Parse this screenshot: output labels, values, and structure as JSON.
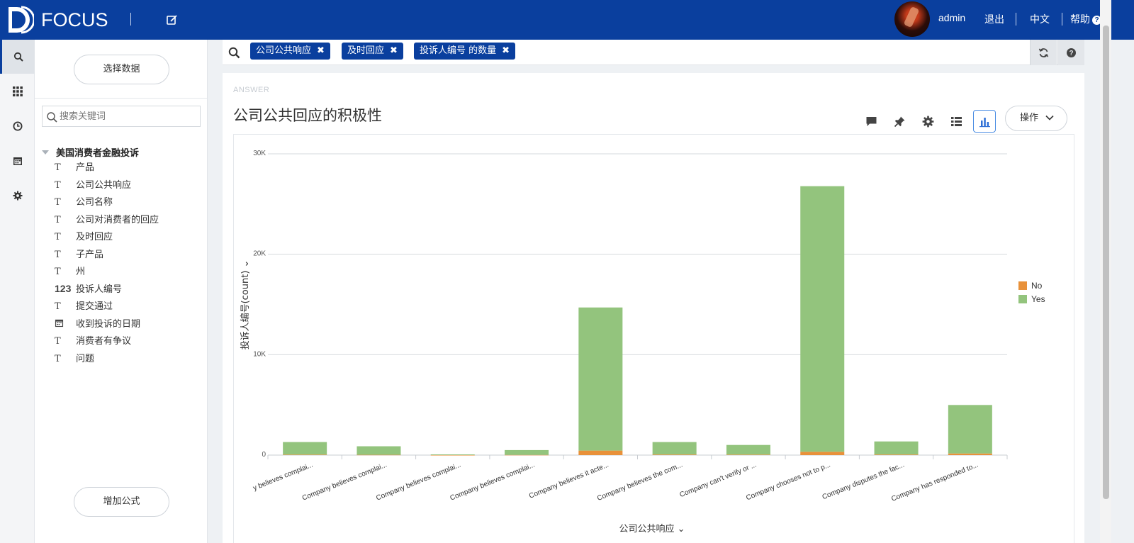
{
  "header": {
    "brand": "FOCUS",
    "user": "admin",
    "logout": "退出",
    "language": "中文",
    "help": "帮助"
  },
  "nav": {
    "items": [
      "search-icon",
      "grid-icon",
      "clock-icon",
      "calendar-icon",
      "gear-icon"
    ],
    "active": "search-icon"
  },
  "data_panel": {
    "select_data_label": "选择数据",
    "search_placeholder": "搜索关键词",
    "source_name": "美国消费者金融投诉",
    "fields": [
      {
        "type": "text",
        "type_label": "T",
        "name": "产品"
      },
      {
        "type": "text",
        "type_label": "T",
        "name": "公司公共响应"
      },
      {
        "type": "text",
        "type_label": "T",
        "name": "公司名称"
      },
      {
        "type": "text",
        "type_label": "T",
        "name": "公司对消费者的回应"
      },
      {
        "type": "text",
        "type_label": "T",
        "name": "及时回应"
      },
      {
        "type": "text",
        "type_label": "T",
        "name": "子产品"
      },
      {
        "type": "text",
        "type_label": "T",
        "name": "州"
      },
      {
        "type": "number",
        "type_label": "123",
        "name": "投诉人编号"
      },
      {
        "type": "text",
        "type_label": "T",
        "name": "提交通过"
      },
      {
        "type": "date",
        "type_label": "calendar",
        "name": "收到投诉的日期"
      },
      {
        "type": "text",
        "type_label": "T",
        "name": "消费者有争议"
      },
      {
        "type": "text",
        "type_label": "T",
        "name": "问题"
      }
    ],
    "add_formula_label": "增加公式"
  },
  "search": {
    "tokens": [
      {
        "label": "公司公共响应"
      },
      {
        "label": "及时回应"
      },
      {
        "label": "投诉人编号 的数量"
      }
    ]
  },
  "answer": {
    "section_label": "ANSWER",
    "title": "公司公共回应的积极性",
    "operations_label": "操作"
  },
  "colors": {
    "brand": "#0a3f9e",
    "series_no": "#e8913a",
    "series_yes": "#93c47d"
  },
  "chart_data": {
    "type": "bar",
    "stacked": true,
    "categories": [
      "Company believes complai...",
      "Company believes complai...",
      "Company believes complai...",
      "Company believes complai...",
      "Company believes it acte...",
      "Company believes the com...",
      "Company can't verify or ...",
      "Company chooses not to p...",
      "Company disputes the fac...",
      "Company has responded to..."
    ],
    "category_tick_labels": [
      "y believes complai...",
      "Company believes complai...",
      "Company believes complai...",
      "Company believes complai...",
      "Company believes it acte...",
      "Company believes the com...",
      "Company can't verify or ...",
      "Company chooses not to p...",
      "Company disputes the fac...",
      "Company has responded to..."
    ],
    "series": [
      {
        "name": "No",
        "values": [
          50,
          30,
          5,
          20,
          450,
          60,
          50,
          330,
          60,
          160
        ]
      },
      {
        "name": "Yes",
        "values": [
          1250,
          850,
          65,
          480,
          14250,
          1240,
          960,
          26450,
          1300,
          4830
        ]
      }
    ],
    "xlabel": "公司公共响应",
    "ylabel": "投诉人编号(count)",
    "ylim": [
      0,
      30000
    ],
    "yticks": [
      0,
      10000,
      20000,
      30000
    ],
    "ytick_labels": [
      "0",
      "10K",
      "20K",
      "30K"
    ],
    "grid": true,
    "legend_position": "right"
  }
}
